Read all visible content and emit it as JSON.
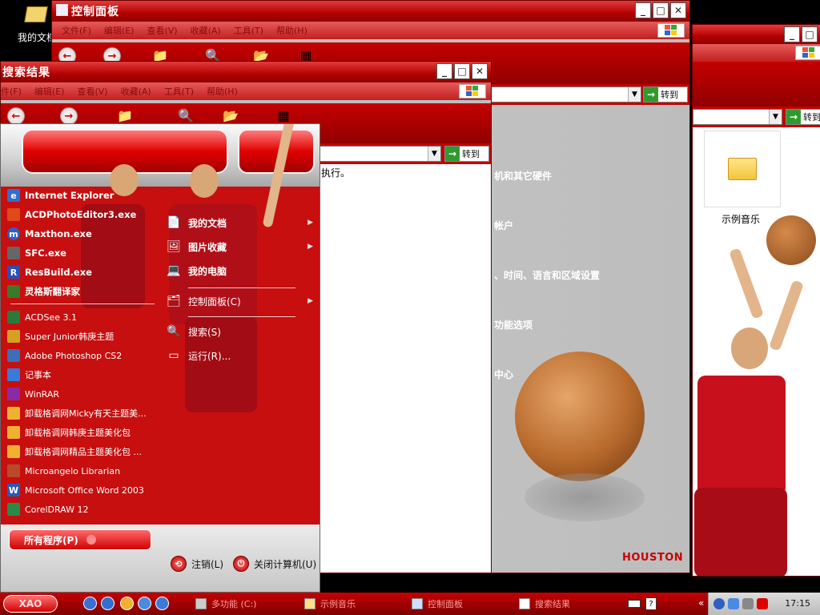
{
  "desktop": {
    "icon_label": "我的文档"
  },
  "control_panel": {
    "title": "控制面板",
    "menu": [
      "文件(F)",
      "编辑(E)",
      "查看(V)",
      "收藏(A)",
      "工具(T)",
      "帮助(H)"
    ],
    "go_label": "转到",
    "items": [
      "机和其它硬件",
      "帐户",
      "、时间、语言和区域设置",
      "功能选项",
      "中心"
    ],
    "brand_text": "HOUSTON"
  },
  "music_window": {
    "go_label": "转到",
    "folder_label": "示例音乐"
  },
  "search_window": {
    "title": "搜索结果",
    "menu": [
      "件(F)",
      "编辑(E)",
      "查看(V)",
      "收藏(A)",
      "工具(T)",
      "帮助(H)"
    ],
    "go_label": "转到",
    "body_text": "执行。"
  },
  "start_menu": {
    "pinned": [
      {
        "label": "Internet Explorer",
        "icon": "ie-icon",
        "color": "#2f6fd1"
      },
      {
        "label": "ACDPhotoEditor3.exe",
        "icon": "acd-photo-editor-icon",
        "color": "#e04a1a"
      },
      {
        "label": "Maxthon.exe",
        "icon": "maxthon-icon",
        "color": "#3060c0"
      },
      {
        "label": "SFC.exe",
        "icon": "sfc-icon",
        "color": "#666666"
      },
      {
        "label": "ResBuild.exe",
        "icon": "resbuild-icon",
        "color": "#2850b8"
      },
      {
        "label": "灵格斯翻译家",
        "icon": "lingoes-icon",
        "color": "#3a7a2a"
      }
    ],
    "recent": [
      {
        "label": "ACDSee 3.1",
        "icon": "acdsee-icon",
        "color": "#2a7a3a"
      },
      {
        "label": "Super Junior韩庚主题",
        "icon": "super-junior-icon",
        "color": "#d8a020"
      },
      {
        "label": "Adobe Photoshop CS2",
        "icon": "photoshop-icon",
        "color": "#3b6fb8"
      },
      {
        "label": "记事本",
        "icon": "notepad-icon",
        "color": "#3a7ad8"
      },
      {
        "label": "WinRAR",
        "icon": "winrar-icon",
        "color": "#8a2aa8"
      },
      {
        "label": "卸载格调网Micky有天主题美...",
        "icon": "uninstall-icon",
        "color": "#f0b030"
      },
      {
        "label": "卸载格调网韩庚主题美化包",
        "icon": "uninstall-icon",
        "color": "#f0b030"
      },
      {
        "label": "卸载格调网精品主题美化包 ...",
        "icon": "uninstall-icon",
        "color": "#f0b030"
      },
      {
        "label": "Microangelo Librarian",
        "icon": "microangelo-icon",
        "color": "#b84a2a"
      },
      {
        "label": "Microsoft Office Word 2003",
        "icon": "word-icon",
        "color": "#2a5ab8"
      },
      {
        "label": "CorelDRAW 12",
        "icon": "coreldraw-icon",
        "color": "#2a8a4a"
      }
    ],
    "right_items": [
      {
        "label": "我的文档",
        "icon": "my-documents-icon"
      },
      {
        "label": "图片收藏",
        "icon": "my-pictures-icon"
      },
      {
        "label": "我的电脑",
        "icon": "my-computer-icon"
      },
      {
        "label": "控制面板(C)",
        "icon": "control-panel-icon"
      },
      {
        "label": "搜索(S)",
        "icon": "search-icon"
      },
      {
        "label": "运行(R)...",
        "icon": "run-icon"
      }
    ],
    "all_programs": "所有程序(P)",
    "logoff": "注销(L)",
    "shutdown": "关闭计算机(U)"
  },
  "taskbar": {
    "start_label": "XAO",
    "tasks": [
      "多功能 (C:)",
      "示例音乐",
      "控制面板",
      "搜索结果"
    ],
    "clock": "17:15"
  }
}
